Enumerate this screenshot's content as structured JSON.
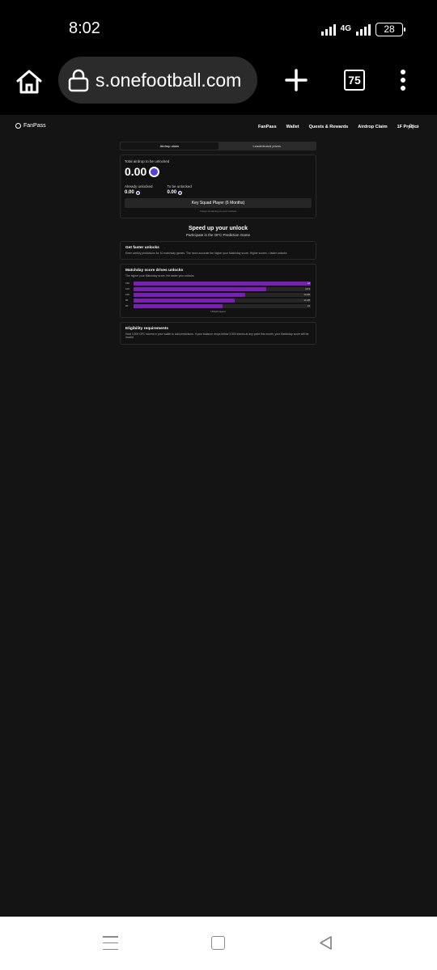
{
  "status": {
    "time": "8:02",
    "network": "4G",
    "battery": "28"
  },
  "browser": {
    "url": "s.onefootball.com",
    "tab_count": "75"
  },
  "site": {
    "brand": "FanPass",
    "nav": [
      "FanPass",
      "Wallet",
      "Quests & Rewards",
      "Airdrop Claim",
      "1F Predict"
    ]
  },
  "tabs": [
    {
      "label": "Airdrop claim",
      "active": true
    },
    {
      "label": "Leaderboard prizes",
      "active": false
    }
  ],
  "airdrop": {
    "total_label": "Total airdrop to be unlocked",
    "total_value": "0.00",
    "already_label": "Already unlocked",
    "already_value": "0.00",
    "tobe_label": "To be unlocked",
    "tobe_value": "0.00",
    "tier_button": "Key Squad Player (6 Months)",
    "tier_note": "0 days remaining on your contract"
  },
  "speed": {
    "title": "Speed up your unlock",
    "subtitle": "Participate in the OFC Prediction Game"
  },
  "faster": {
    "title": "Get faster unlocks",
    "text": "Enter weekly predictions for 10 matchday games. The more accurate the higher your Matchday score. Higher scores = faster unlocks"
  },
  "matchday": {
    "title": "Matchday score drives unlocks",
    "text": "The higher your Matchday score, the faster your unlocks",
    "bars": [
      {
        "label": "150",
        "fill": 1.0,
        "value": "x2"
      },
      {
        "label": "120",
        "fill": 0.75,
        "value": "x1.5"
      },
      {
        "label": "100",
        "fill": 0.63,
        "value": "x1.25"
      },
      {
        "label": "80",
        "fill": 0.57,
        "value": "x1.15"
      },
      {
        "label": "60",
        "fill": 0.5,
        "value": "x1"
      }
    ],
    "caption": "Unlock speed"
  },
  "eligibility": {
    "title": "Eligibility requirements",
    "text": "Hold 3,500 OFC tokens in your wallet to add predictions. If your balance drops below 3,500 tokens at any point this month, your Matchday score will be invalid."
  }
}
